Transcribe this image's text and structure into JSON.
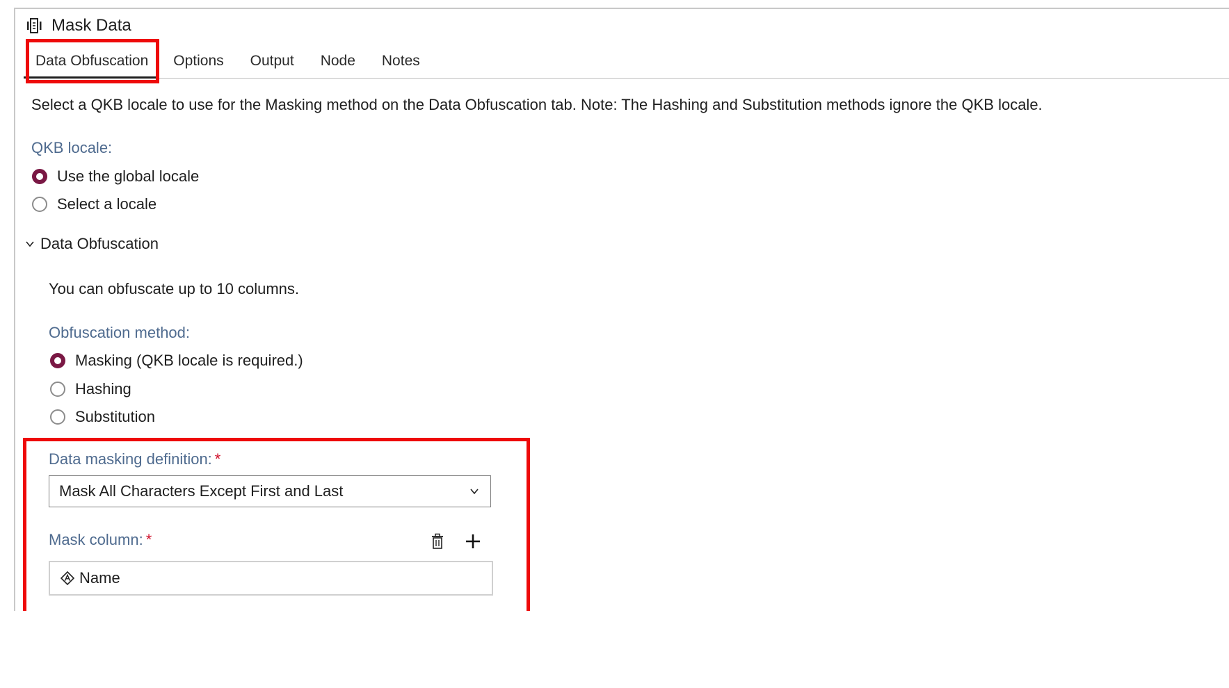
{
  "window": {
    "title": "Mask Data",
    "icon": "mask-data-icon"
  },
  "tabs": [
    {
      "label": "Data Obfuscation",
      "active": true
    },
    {
      "label": "Options",
      "active": false
    },
    {
      "label": "Output",
      "active": false
    },
    {
      "label": "Node",
      "active": false
    },
    {
      "label": "Notes",
      "active": false
    }
  ],
  "intro_text": "Select a QKB locale to use for the Masking method on the Data Obfuscation tab. Note: The Hashing and Substitution methods ignore the QKB locale.",
  "qkb_locale": {
    "label": "QKB locale:",
    "options": [
      {
        "label": "Use the global locale",
        "selected": true
      },
      {
        "label": "Select a locale",
        "selected": false
      }
    ]
  },
  "data_obfuscation_section": {
    "title": "Data Obfuscation",
    "expanded": true,
    "note": "You can obfuscate up to 10 columns.",
    "method": {
      "label": "Obfuscation method:",
      "options": [
        {
          "label": "Masking (QKB locale is required.)",
          "selected": true
        },
        {
          "label": "Hashing",
          "selected": false
        },
        {
          "label": "Substitution",
          "selected": false
        }
      ]
    },
    "masking_definition": {
      "label": "Data masking definition:",
      "required_mark": "*",
      "value": "Mask All Characters Except First and Last"
    },
    "mask_column": {
      "label": "Mask column:",
      "required_mark": "*",
      "value": "Name",
      "value_icon": "character-column-icon",
      "actions": [
        "delete-icon",
        "add-icon"
      ]
    }
  },
  "colors": {
    "accent_radio": "#7a1844",
    "label_blue": "#4f6b8f",
    "required": "#d0102b",
    "highlight_box": "#ee0a0a"
  }
}
